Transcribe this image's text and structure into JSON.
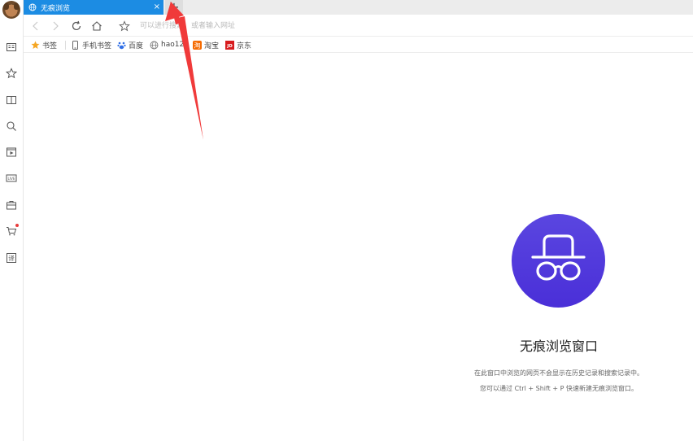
{
  "window": {
    "accent": "#1c8ce3"
  },
  "tabs": [
    {
      "title": "无痕浏览",
      "close": "×",
      "icon": "globe-icon"
    }
  ],
  "newtab": {
    "label": "+"
  },
  "omnibox": {
    "placeholder": "可以进行搜索，或者输入网址"
  },
  "bookmarks": [
    {
      "label": "书签",
      "icon": "star-icon"
    },
    {
      "label": "手机书签",
      "icon": "phone-icon"
    },
    {
      "label": "百度",
      "icon": "baidu-paw-icon"
    },
    {
      "label": "hao123",
      "icon": "globe-icon"
    },
    {
      "label": "淘宝",
      "icon": "taobao-icon"
    },
    {
      "label": "京东",
      "icon": "jd-icon"
    }
  ],
  "sidebar": {
    "items": [
      "news-icon",
      "favorites-star-icon",
      "reader-book-icon",
      "search-icon",
      "video-icon",
      "live-icon",
      "case-icon",
      "cart-icon",
      "translate-icon"
    ]
  },
  "incognito": {
    "title": "无痕浏览窗口",
    "line1": "在此窗口中浏览的网页不会显示在历史记录和搜索记录中。",
    "line2": "您可以通过 Ctrl + Shift + P 快速新建无痕浏览窗口。",
    "circle_color": "#4f3adc"
  },
  "annotation": {
    "color": "#f03a3a"
  }
}
